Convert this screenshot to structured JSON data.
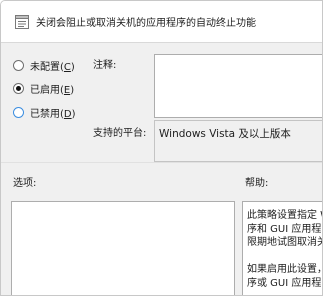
{
  "dialog": {
    "title": "关闭会阻止或取消关机的应用程序的自动终止功能"
  },
  "state_options": [
    {
      "label": "未配置(",
      "key": "C",
      "suffix": ")",
      "selected": false
    },
    {
      "label": "已启用(",
      "key": "E",
      "suffix": ")",
      "selected": true
    },
    {
      "label": "已禁用(",
      "key": "D",
      "suffix": ")",
      "selected": false
    }
  ],
  "comment": {
    "label": "注释:",
    "value": ""
  },
  "supported": {
    "label": "支持的平台:",
    "value": "Windows Vista 及以上版本"
  },
  "options": {
    "label": "选项:"
  },
  "help": {
    "label": "帮助:",
    "lines": [
      "此策略设置指定 W",
      "序和 GUI 应用程",
      "限期地试图取消关",
      "",
      "如果启用此设置，",
      "序或 GUI 应用程"
    ]
  },
  "colors": {
    "header_bg": "#ffffff",
    "dialog_bg": "#f0f0f0",
    "radio_focus": "#3c8ee0"
  }
}
